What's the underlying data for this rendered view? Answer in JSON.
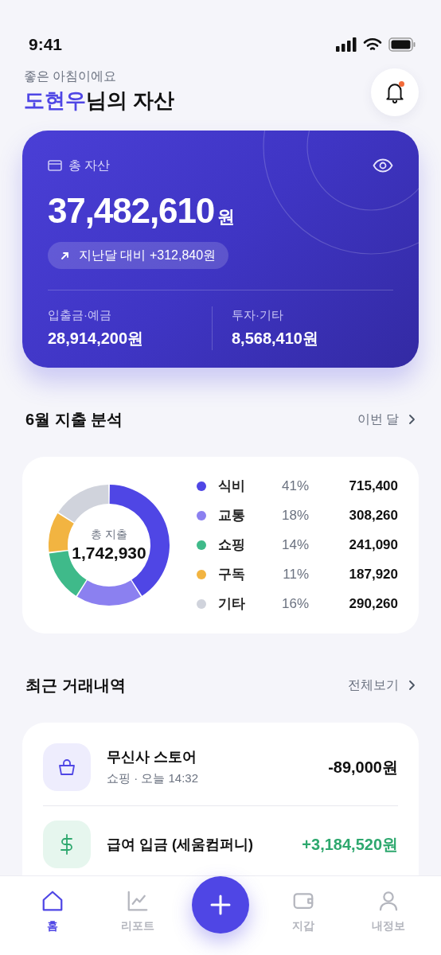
{
  "status_bar": {
    "time": "9:41"
  },
  "header": {
    "greeting": "좋은 아침이에요",
    "name": "도현우",
    "title_rest": "님의 자산",
    "notification_unread": true
  },
  "asset_card": {
    "label": "총 자산",
    "amount": "37,482,610",
    "unit": "원",
    "change": "지난달 대비 +312,840원",
    "breakdown": [
      {
        "label": "입출금·예금",
        "amount": "28,914,200원"
      },
      {
        "label": "투자·기타",
        "amount": "8,568,410원"
      }
    ]
  },
  "spending": {
    "title": "6월 지출 분석",
    "link": "이번 달",
    "center_label": "총 지출",
    "total": "1,742,930",
    "chart_data": {
      "type": "donut",
      "categories": [
        "식비",
        "교통",
        "쇼핑",
        "구독",
        "기타"
      ],
      "values": [
        41,
        18,
        14,
        11,
        16
      ]
    },
    "legend": [
      {
        "percent": "41%",
        "amount": "715,400",
        "color": "#4f46e5"
      },
      {
        "percent": "18%",
        "amount": "308,260",
        "color": "#8b80f0"
      },
      {
        "percent": "14%",
        "amount": "241,090",
        "color": "#3fba8a"
      },
      {
        "percent": "11%",
        "amount": "187,920",
        "color": "#f2b441"
      },
      {
        "percent": "16%",
        "amount": "290,260",
        "color": "#d0d3dc"
      }
    ]
  },
  "transactions": {
    "title": "최근 거래내역",
    "link": "전체보기",
    "items": [
      {
        "kind": "expense",
        "name": "무신사 스토어",
        "meta": "쇼핑 · 오늘 14:32",
        "amount": "-89,000원"
      },
      {
        "kind": "income",
        "name": "급여 입금 (세움컴퍼니)",
        "amount": "+3,184,520원"
      }
    ]
  },
  "nav": {
    "items": [
      {
        "kind": "home",
        "label": "홈",
        "selected": true
      },
      {
        "kind": "report",
        "label": "리포트",
        "selected": false
      },
      {
        "kind": "add"
      },
      {
        "kind": "wallet",
        "label": "지갑",
        "selected": false
      },
      {
        "kind": "profile",
        "label": "내정보",
        "selected": false
      }
    ]
  }
}
